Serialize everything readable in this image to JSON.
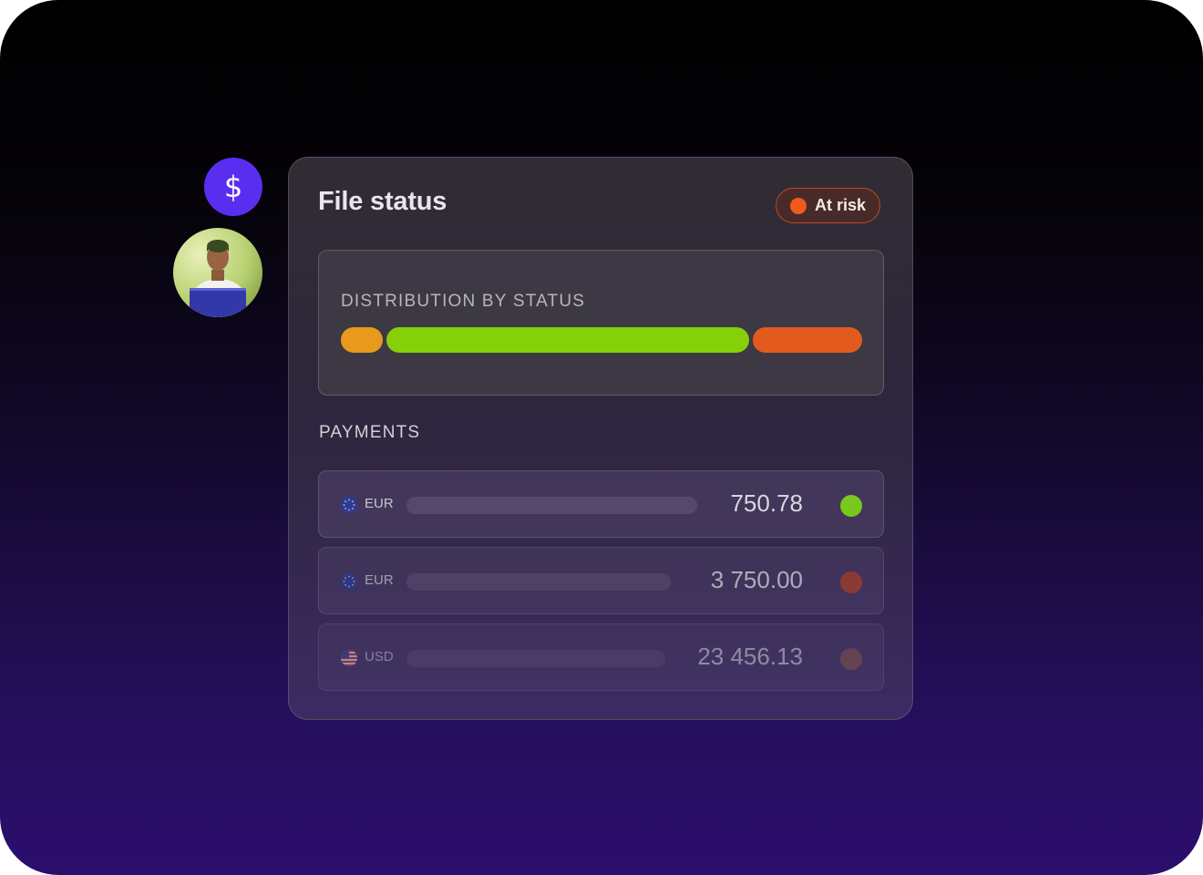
{
  "card": {
    "title": "File status",
    "badge": {
      "label": "At risk",
      "dot_color": "#f05a1a",
      "border_color": "#c24a1e"
    }
  },
  "distribution": {
    "heading": "DISTRIBUTION BY STATUS",
    "segments": [
      {
        "status": "pending",
        "share": 0.08,
        "color": "#e89a1c"
      },
      {
        "status": "paid",
        "share": 0.7,
        "color": "#86d00a"
      },
      {
        "status": "at-risk",
        "share": 0.21,
        "color": "#e35a1e"
      }
    ]
  },
  "payments": {
    "heading": "PAYMENTS",
    "rows": [
      {
        "flag": "eu-flag-icon",
        "currency": "EUR",
        "amount": "750.78",
        "status_color": "#78c81e",
        "track_fill": 0.55,
        "opacity": 1.0
      },
      {
        "flag": "eu-flag-icon",
        "currency": "EUR",
        "amount": "3 750.00",
        "status_color": "#a8402a",
        "track_fill": 0.5,
        "opacity": 0.75
      },
      {
        "flag": "us-flag-icon",
        "currency": "USD",
        "amount": "23 456.13",
        "status_color": "#8a5a4a",
        "track_fill": 0.49,
        "opacity": 0.55
      }
    ]
  },
  "side": {
    "dollar_icon": "$",
    "accent": "#5a2ef0"
  }
}
